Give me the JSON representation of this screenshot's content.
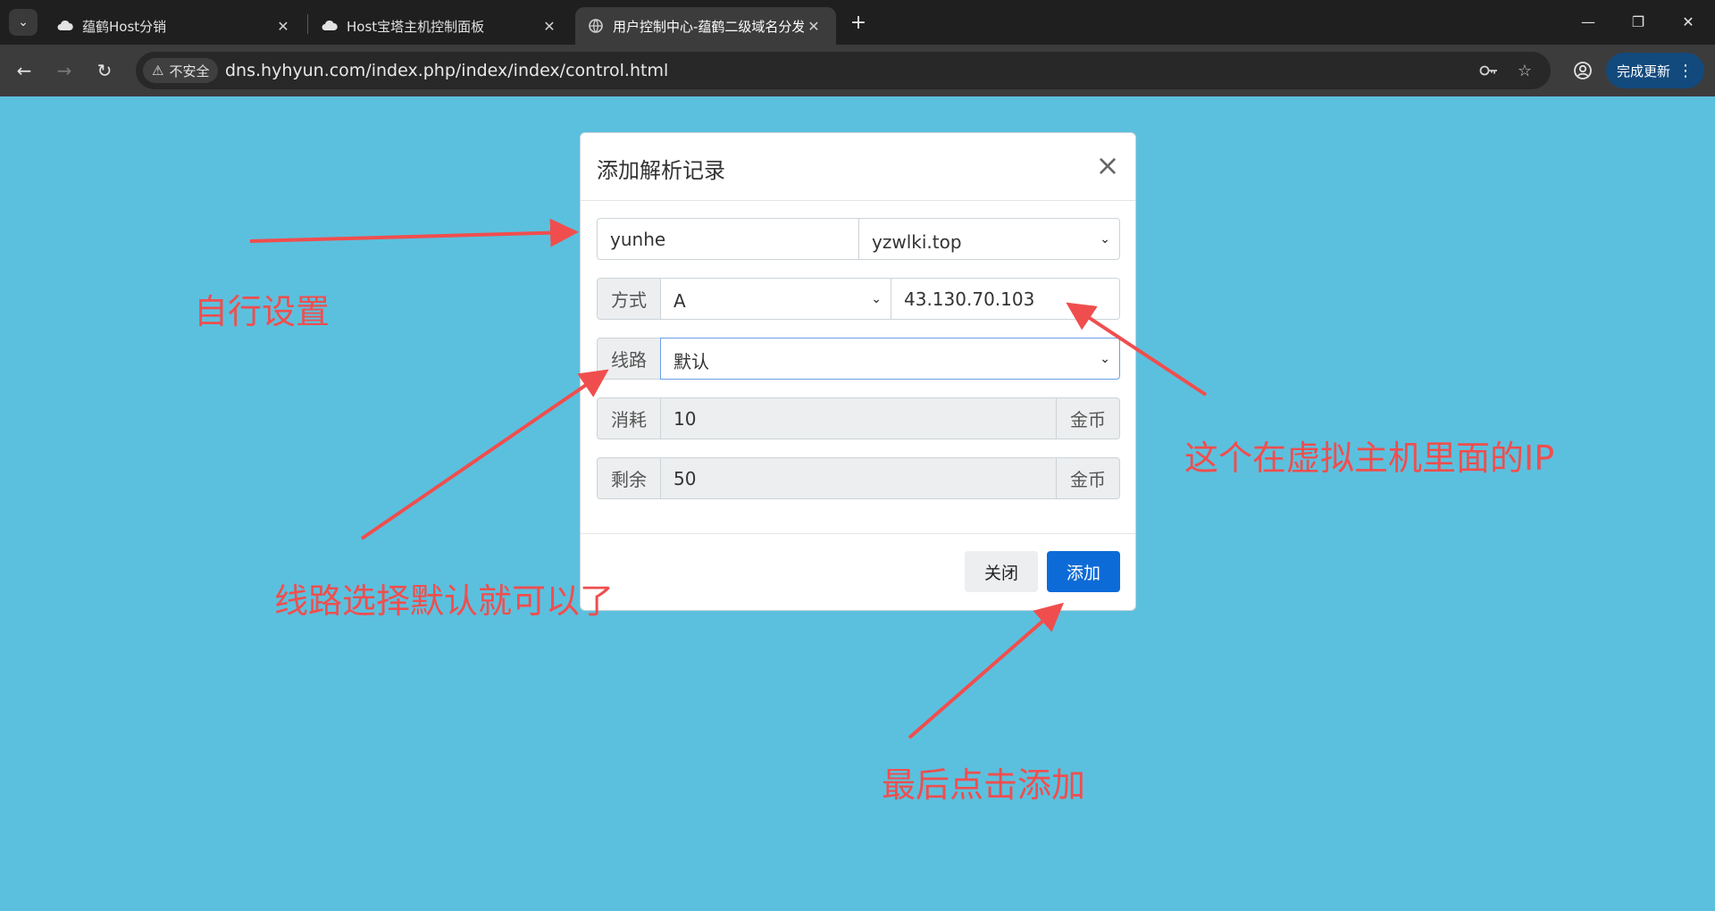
{
  "browser": {
    "tabs": [
      {
        "title": "蕴鹤Host分销",
        "active": false,
        "icon": "cloud-icon"
      },
      {
        "title": "Host宝塔主机控制面板",
        "active": false,
        "icon": "cloud-icon"
      },
      {
        "title": "用户控制中心-蕴鹤二级域名分发",
        "active": true,
        "icon": "globe-icon"
      }
    ],
    "security_label": "不安全",
    "url": "dns.hyhyun.com/index.php/index/index/control.html",
    "update_button": "完成更新"
  },
  "modal": {
    "title": "添加解析记录",
    "host_value": "yunhe",
    "domain_selected": "yzwlki.top",
    "method_label": "方式",
    "type_selected": "A",
    "ip_value": "43.130.70.103",
    "line_label": "线路",
    "line_selected": "默认",
    "cost_label": "消耗",
    "cost_value": "10",
    "cost_unit": "金币",
    "remain_label": "剩余",
    "remain_value": "50",
    "remain_unit": "金币",
    "close_button": "关闭",
    "add_button": "添加"
  },
  "annotations": {
    "custom_setting": "自行设置",
    "ip_note": "这个在虚拟主机里面的IP",
    "line_note": "线路选择默认就可以了",
    "final_note": "最后点击添加",
    "color": "#f04e4e"
  }
}
